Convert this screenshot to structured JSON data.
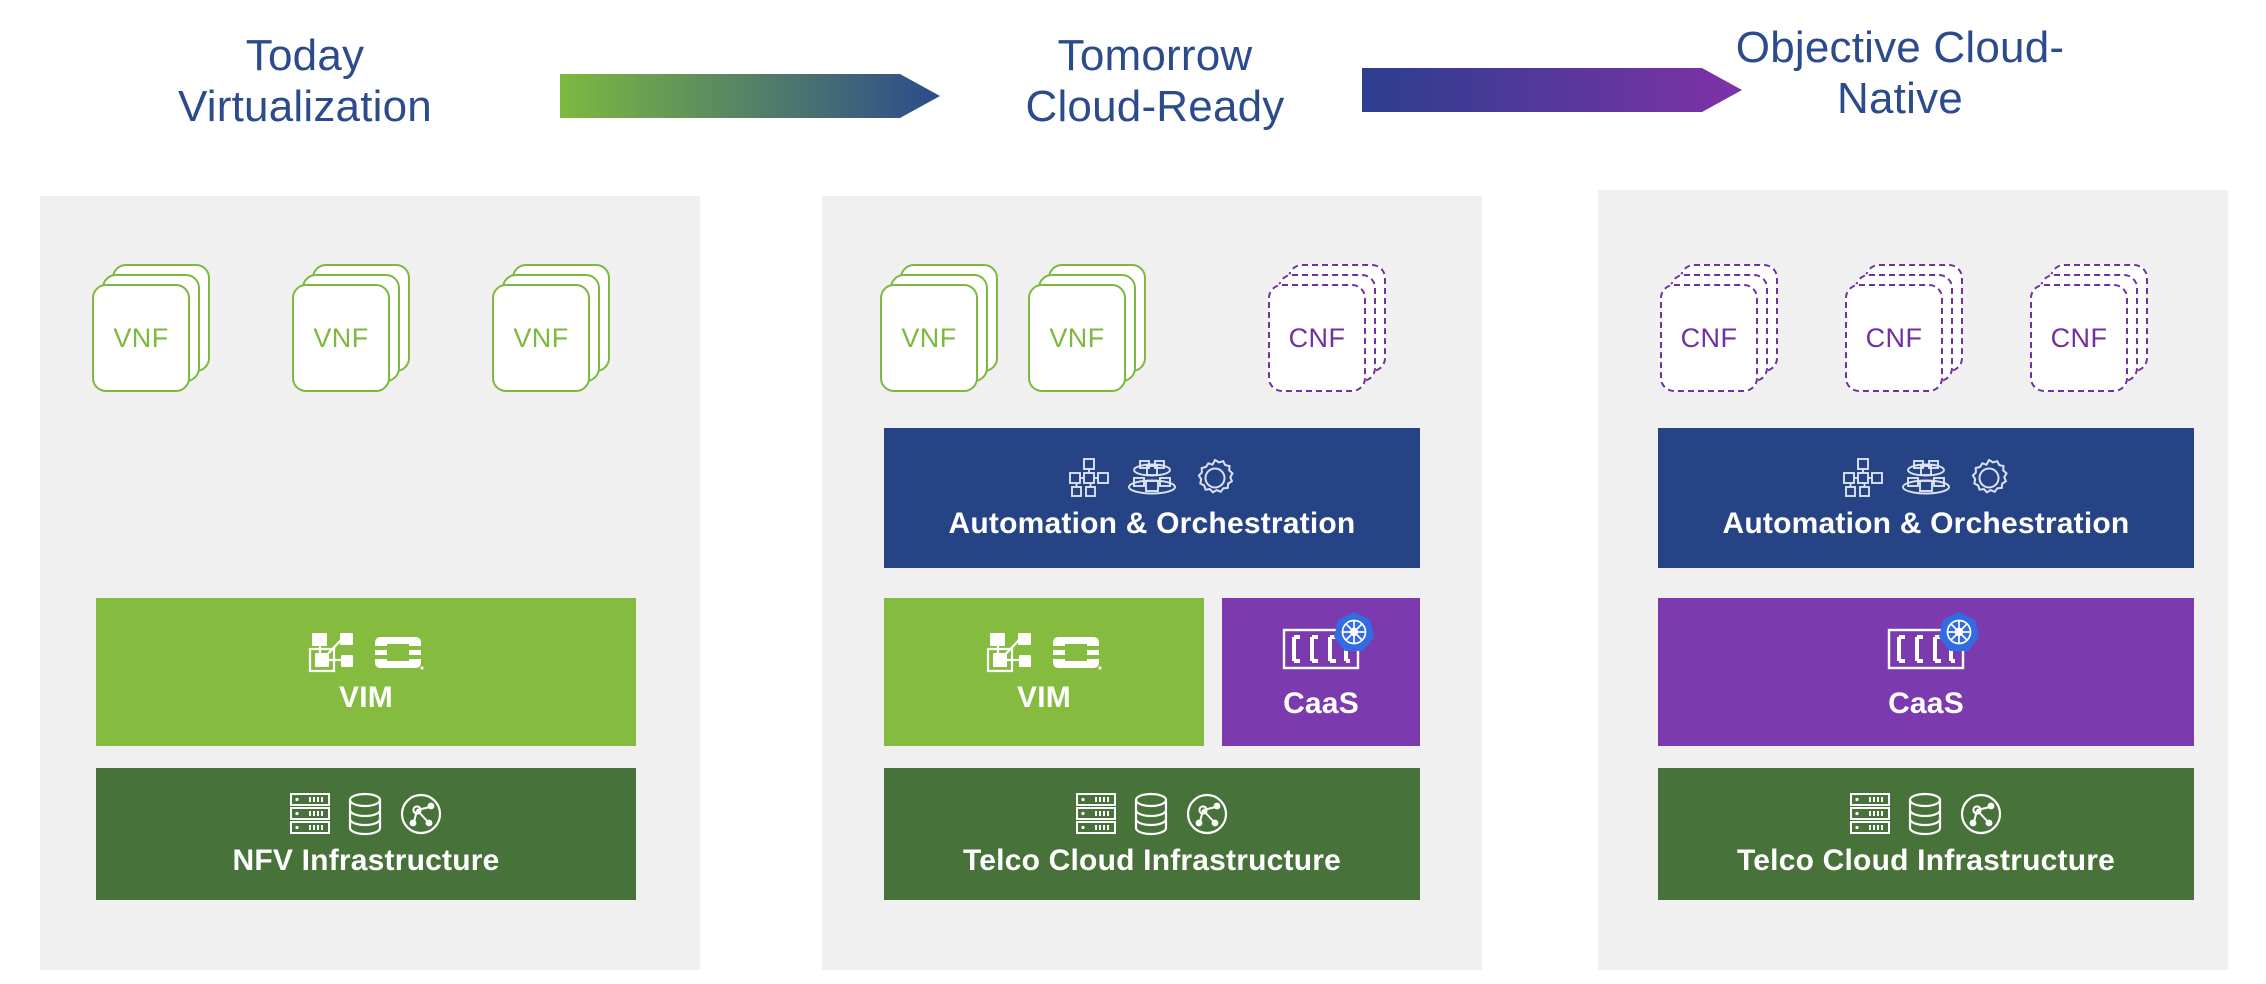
{
  "headers": [
    {
      "line1": "Today",
      "line2": "Virtualization"
    },
    {
      "line1": "Tomorrow",
      "line2": "Cloud-Ready"
    },
    {
      "line1": "Objective Cloud-",
      "line2": "Native"
    }
  ],
  "arrows": [
    {
      "name": "arrow-today-to-tomorrow",
      "from": "#7DB93F",
      "to": "#2B4B8C"
    },
    {
      "name": "arrow-tomorrow-to-objective",
      "from": "#2B3E8F",
      "to": "#8031A7"
    }
  ],
  "colors": {
    "title_blue": "#2B4B8C",
    "panel_bg": "#F0F0F0",
    "vnf_green": "#7DB93F",
    "cnf_purple": "#7030A0",
    "orchestration_navy": "#254385",
    "vim_green": "#85BC40",
    "caas_purple": "#7B3BAF",
    "infra_green": "#47723A",
    "kubernetes_blue": "#326CE5",
    "white": "#FFFFFF"
  },
  "columns": [
    {
      "id": "today",
      "functions": [
        {
          "type": "VNF",
          "label": "VNF"
        },
        {
          "type": "VNF",
          "label": "VNF"
        },
        {
          "type": "VNF",
          "label": "VNF"
        }
      ],
      "bars": [
        {
          "id": "vim",
          "label": "VIM",
          "icons": [
            "vsphere-node-icon",
            "openstack-logo-icon"
          ]
        },
        {
          "id": "nfvi",
          "label": "NFV Infrastructure",
          "icons": [
            "server-rack-icon",
            "database-icon",
            "network-topology-icon"
          ]
        }
      ]
    },
    {
      "id": "tomorrow",
      "functions": [
        {
          "type": "VNF",
          "label": "VNF"
        },
        {
          "type": "VNF",
          "label": "VNF"
        },
        {
          "type": "CNF",
          "label": "CNF"
        }
      ],
      "bars": [
        {
          "id": "orchestration",
          "label": "Automation & Orchestration",
          "icons": [
            "network-nodes-icon",
            "cloud-layers-icon",
            "gear-icon"
          ]
        },
        {
          "id": "vim",
          "label": "VIM",
          "icons": [
            "vsphere-node-icon",
            "openstack-logo-icon"
          ]
        },
        {
          "id": "caas",
          "label": "CaaS",
          "icons": [
            "containers-icon",
            "kubernetes-icon"
          ]
        },
        {
          "id": "tci",
          "label": "Telco Cloud Infrastructure",
          "icons": [
            "server-rack-icon",
            "database-icon",
            "network-topology-icon"
          ]
        }
      ]
    },
    {
      "id": "objective",
      "functions": [
        {
          "type": "CNF",
          "label": "CNF"
        },
        {
          "type": "CNF",
          "label": "CNF"
        },
        {
          "type": "CNF",
          "label": "CNF"
        }
      ],
      "bars": [
        {
          "id": "orchestration",
          "label": "Automation & Orchestration",
          "icons": [
            "network-nodes-icon",
            "cloud-layers-icon",
            "gear-icon"
          ]
        },
        {
          "id": "caas",
          "label": "CaaS",
          "icons": [
            "containers-icon",
            "kubernetes-icon"
          ]
        },
        {
          "id": "tci",
          "label": "Telco Cloud Infrastructure",
          "icons": [
            "server-rack-icon",
            "database-icon",
            "network-topology-icon"
          ]
        }
      ]
    }
  ]
}
